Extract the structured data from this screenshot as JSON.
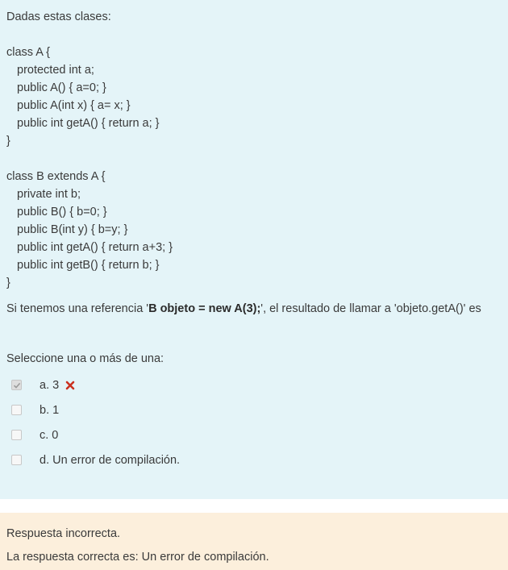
{
  "question": {
    "intro": "Dadas estas clases:",
    "classA": [
      "class A {",
      "protected int a;",
      "public A() { a=0; }",
      "public A(int x) { a= x; }",
      "public int getA() { return a; }",
      "}"
    ],
    "classB": [
      "class B extends A {",
      "private int b;",
      "public B() { b=0; }",
      "public B(int y) { b=y; }",
      "public int getA() { return a+3; }",
      "public int getB() { return b; }",
      "}"
    ],
    "prompt": {
      "before": "Si tenemos una referencia '",
      "bold": "B objeto = new A(3);",
      "after": "', el resultado de llamar a 'objeto.getA()' es"
    },
    "select_label": "Seleccione una o más de una:",
    "options": [
      {
        "label": "a. 3",
        "checked": true,
        "incorrect": true
      },
      {
        "label": "b. 1",
        "checked": false
      },
      {
        "label": "c. 0",
        "checked": false
      },
      {
        "label": "d. Un error de compilación.",
        "checked": false
      }
    ]
  },
  "feedback": {
    "status": "Respuesta incorrecta.",
    "correct_answer": "La respuesta correcta es: Un error de compilación."
  },
  "colors": {
    "question_bg": "#e4f4f8",
    "feedback_bg": "#fcefdc",
    "incorrect_mark": "#ca3120"
  }
}
